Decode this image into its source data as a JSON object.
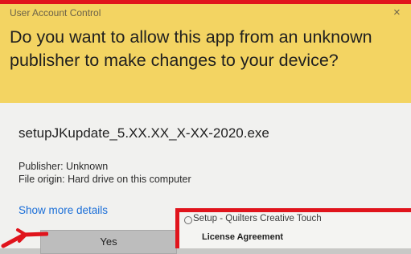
{
  "uac": {
    "title": "User Account Control",
    "close": "×",
    "question": "Do you want to allow this app from an unknown publisher to make changes to your device?",
    "file_name": "setupJKupdate_5.XX.XX_X-XX-2020.exe",
    "publisher": "Publisher: Unknown",
    "file_origin": "File origin: Hard drive on this computer",
    "show_more": "Show more details",
    "yes_label": "Yes",
    "colors": {
      "header_bg": "#f3d462",
      "accent_red": "#e0141c",
      "link": "#1a6ed8"
    }
  },
  "setup": {
    "title": "Setup - Quilters Creative Touch",
    "heading": "License Agreement"
  }
}
